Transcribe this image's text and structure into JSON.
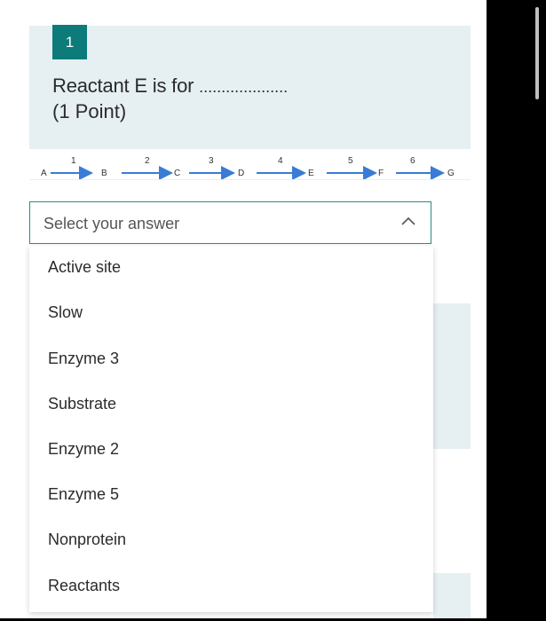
{
  "question": {
    "number": "1",
    "text": "Reactant E is for",
    "blank": "....................",
    "points": "(1 Point)"
  },
  "diagram": {
    "nodes": [
      "A",
      "B",
      "C",
      "D",
      "E",
      "F",
      "G"
    ],
    "steps": [
      "1",
      "2",
      "3",
      "4",
      "5",
      "6"
    ],
    "arrow_color": "#3a7bd5"
  },
  "dropdown": {
    "placeholder": "Select your answer",
    "options": [
      "Active site",
      "Slow",
      "Enzyme 3",
      "Substrate",
      "Enzyme 2",
      "Enzyme 5",
      "Nonprotein",
      "Reactants"
    ]
  },
  "colors": {
    "accent": "#0e7b7b",
    "card_bg": "#e6eff2"
  }
}
